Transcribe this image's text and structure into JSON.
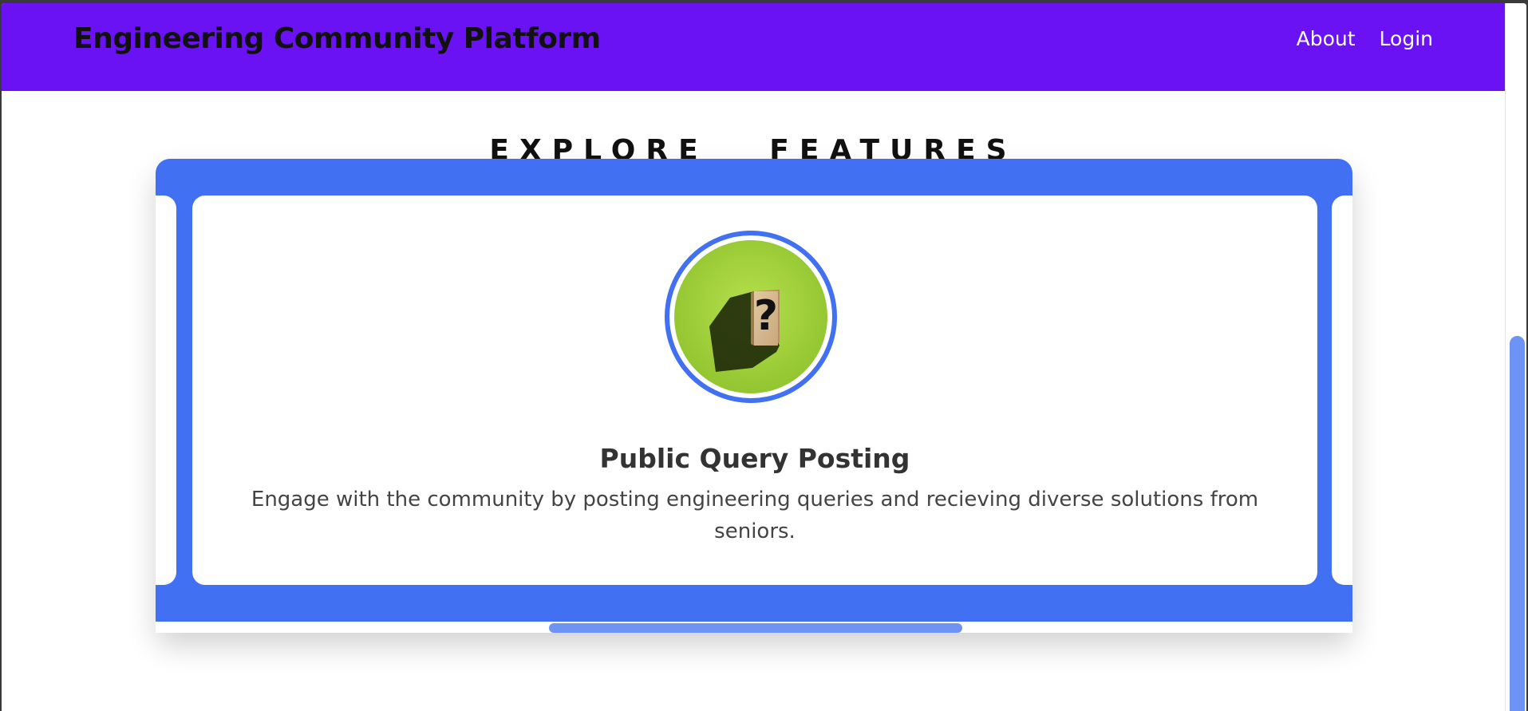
{
  "header": {
    "brand": "Engineering Community Platform",
    "nav": [
      "About",
      "Login"
    ]
  },
  "section": {
    "title": "EXPLORE   FEATURES"
  },
  "carousel": {
    "card": {
      "icon": "question-mark-block-image",
      "title": "Public Query Posting",
      "description": "Engage with the community by posting engineering queries and recieving diverse solutions from seniors."
    }
  },
  "colors": {
    "navbar": "#6b12f5",
    "accent": "#4171f2",
    "scroll_thumb": "#6d93f5"
  }
}
